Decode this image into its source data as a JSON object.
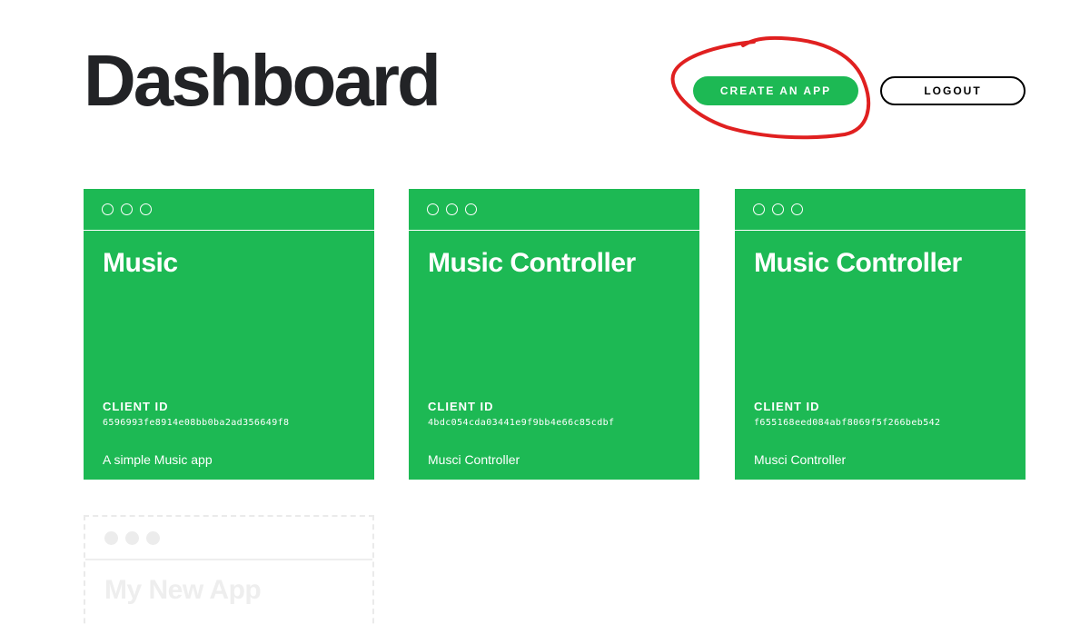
{
  "header": {
    "title": "Dashboard",
    "create_label": "CREATE AN APP",
    "logout_label": "LOGOUT"
  },
  "apps": [
    {
      "name": "Music",
      "client_id_label": "CLIENT ID",
      "client_id": "6596993fe8914e08bb0ba2ad356649f8",
      "description": "A simple Music app"
    },
    {
      "name": "Music Controller",
      "client_id_label": "CLIENT ID",
      "client_id": "4bdc054cda03441e9f9bb4e66c85cdbf",
      "description": "Musci Controller"
    },
    {
      "name": "Music Controller",
      "client_id_label": "CLIENT ID",
      "client_id": "f655168eed084abf8069f5f266beb542",
      "description": "Musci Controller"
    }
  ],
  "new_app": {
    "name": "My New App"
  },
  "colors": {
    "brand_green": "#1db954",
    "title": "#222326",
    "annotation_red": "#e02020"
  }
}
